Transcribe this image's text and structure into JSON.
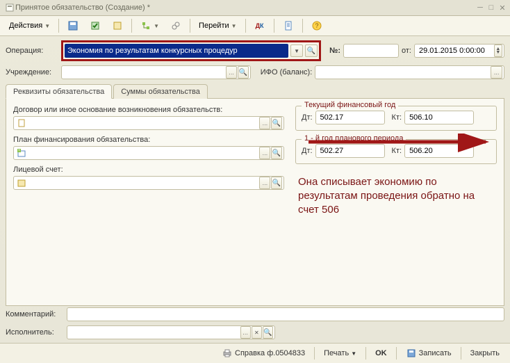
{
  "window": {
    "title": "Принятое обязательство (Создание) *"
  },
  "toolbar": {
    "actions": "Действия",
    "goto": "Перейти"
  },
  "header": {
    "op_label": "Операция:",
    "op_value": "Экономия по результатам конкурсных процедур",
    "num_label": "№:",
    "num_value": "",
    "from_label": "от:",
    "from_value": "29.01.2015 0:00:00",
    "inst_label": "Учреждение:",
    "inst_value": "",
    "ifo_label": "ИФО (баланс):",
    "ifo_value": ""
  },
  "tabs": {
    "t1": "Реквизиты обязательства",
    "t2": "Суммы обязательства"
  },
  "pane": {
    "contract_label": "Договор или иное основание возникновения обязательств:",
    "contract_value": "",
    "plan_label": "План финансирования обязательства:",
    "plan_value": "",
    "account_label": "Лицевой счет:",
    "account_value": ""
  },
  "fin_current": {
    "legend": "Текущий финансовый год",
    "dt_label": "Дт:",
    "dt_value": "502.17",
    "kt_label": "Кт:",
    "kt_value": "506.10"
  },
  "fin_plan1": {
    "legend": "1 - й год планового периода",
    "dt_label": "Дт:",
    "dt_value": "502.27",
    "kt_label": "Кт:",
    "kt_value": "506.20"
  },
  "annotation": "Она списывает экономию по результатам проведения обратно на счет 506",
  "footer": {
    "comment_label": "Комментарий:",
    "comment_value": "",
    "executor_label": "Исполнитель:",
    "executor_value": ""
  },
  "status": {
    "print_form": "Справка ф.0504833",
    "print": "Печать",
    "ok": "OK",
    "save": "Записать",
    "close": "Закрыть"
  }
}
